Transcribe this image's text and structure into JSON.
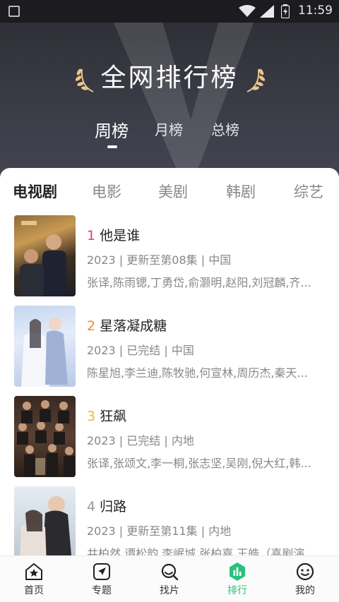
{
  "status_bar": {
    "time": "11:59"
  },
  "header": {
    "title": "全网排行榜",
    "period_tabs": [
      {
        "label": "周榜",
        "active": true
      },
      {
        "label": "月榜",
        "active": false
      },
      {
        "label": "总榜",
        "active": false
      }
    ]
  },
  "category_tabs": [
    {
      "label": "电视剧",
      "active": true
    },
    {
      "label": "电影",
      "active": false
    },
    {
      "label": "美剧",
      "active": false
    },
    {
      "label": "韩剧",
      "active": false
    },
    {
      "label": "综艺",
      "active": false
    }
  ],
  "rank_colors": {
    "1": "#f0366a",
    "2": "#f58a25",
    "3": "#f2b72d",
    "4": "#999999"
  },
  "list": [
    {
      "rank": "1",
      "title": "他是谁",
      "meta": "2023 | 更新至第08集 | 中国",
      "cast": "张译,陈雨锶,丁勇岱,俞灏明,赵阳,刘冠麟,齐..."
    },
    {
      "rank": "2",
      "title": "星落凝成糖",
      "meta": "2023 | 已完结 | 中国",
      "cast": "陈星旭,李兰迪,陈牧驰,何宣林,周历杰,秦天..."
    },
    {
      "rank": "3",
      "title": "狂飙",
      "meta": "2023 | 已完结 | 内地",
      "cast": "张译,张颂文,李一桐,张志坚,吴刚,倪大红,韩..."
    },
    {
      "rank": "4",
      "title": "归路",
      "meta": "2023 | 更新至第11集 | 内地",
      "cast": "井柏然,谭松韵,李岷城,张柏嘉,王皓（喜剧演"
    }
  ],
  "bottom_nav": [
    {
      "label": "首页",
      "icon": "home-icon",
      "active": false
    },
    {
      "label": "专题",
      "icon": "topic-icon",
      "active": false
    },
    {
      "label": "找片",
      "icon": "search-icon",
      "active": false
    },
    {
      "label": "排行",
      "icon": "ranking-icon",
      "active": true
    },
    {
      "label": "我的",
      "icon": "profile-icon",
      "active": false
    }
  ]
}
